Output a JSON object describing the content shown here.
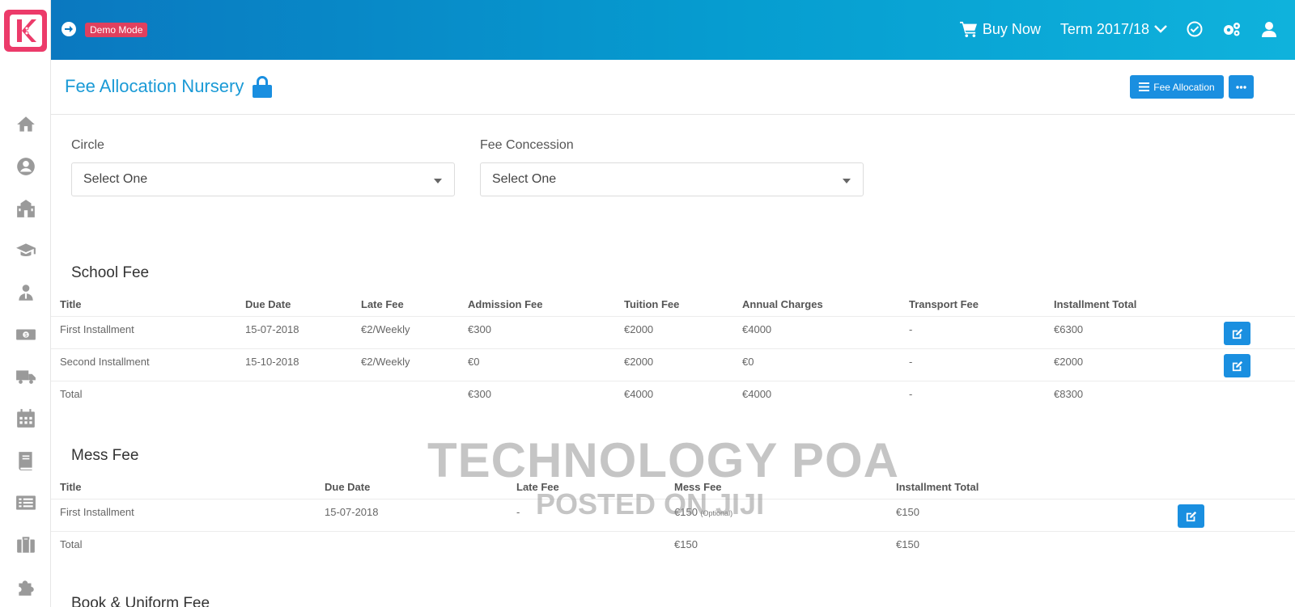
{
  "topbar": {
    "demo_badge": "Demo Mode",
    "buy_now": "Buy Now",
    "term": "Term 2017/18"
  },
  "page": {
    "title": "Fee Allocation Nursery",
    "fee_allocation_button": "Fee Allocation"
  },
  "filters": {
    "circle_label": "Circle",
    "circle_value": "Select One",
    "concession_label": "Fee Concession",
    "concession_value": "Select One"
  },
  "school_fee": {
    "title": "School Fee",
    "headers": [
      "Title",
      "Due Date",
      "Late Fee",
      "Admission Fee",
      "Tuition Fee",
      "Annual Charges",
      "Transport Fee",
      "Installment Total"
    ],
    "rows": [
      [
        "First Installment",
        "15-07-2018",
        "€2/Weekly",
        "€300",
        "€2000",
        "€4000",
        "-",
        "€6300"
      ],
      [
        "Second Installment",
        "15-10-2018",
        "€2/Weekly",
        "€0",
        "€2000",
        "€0",
        "-",
        "€2000"
      ]
    ],
    "total": [
      "Total",
      "",
      "",
      "€300",
      "€4000",
      "€4000",
      "-",
      "€8300"
    ]
  },
  "mess_fee": {
    "title": "Mess Fee",
    "headers": [
      "Title",
      "Due Date",
      "Late Fee",
      "Mess Fee",
      "Installment Total"
    ],
    "rows": [
      [
        "First Installment",
        "15-07-2018",
        "-",
        "€150",
        "€150"
      ]
    ],
    "optional_note": "(Optional)",
    "total": [
      "Total",
      "",
      "",
      "€150",
      "€150"
    ]
  },
  "book_fee": {
    "title": "Book & Uniform Fee"
  },
  "watermark": {
    "line1": "TECHNOLOGY POA",
    "line2": "POSTED ON JIJI"
  },
  "colors": {
    "primary": "#1a8fe0",
    "title_blue": "#1a9ad6",
    "brand_pink": "#ec3b6a",
    "badge_red": "#e0405e"
  },
  "icons": {
    "sidebar": [
      "home-icon",
      "user-circle-icon",
      "school-icon",
      "graduation-cap-icon",
      "teacher-icon",
      "money-icon",
      "truck-icon",
      "calendar-icon",
      "book-icon",
      "list-icon",
      "briefcase-icon",
      "puzzle-icon"
    ]
  }
}
